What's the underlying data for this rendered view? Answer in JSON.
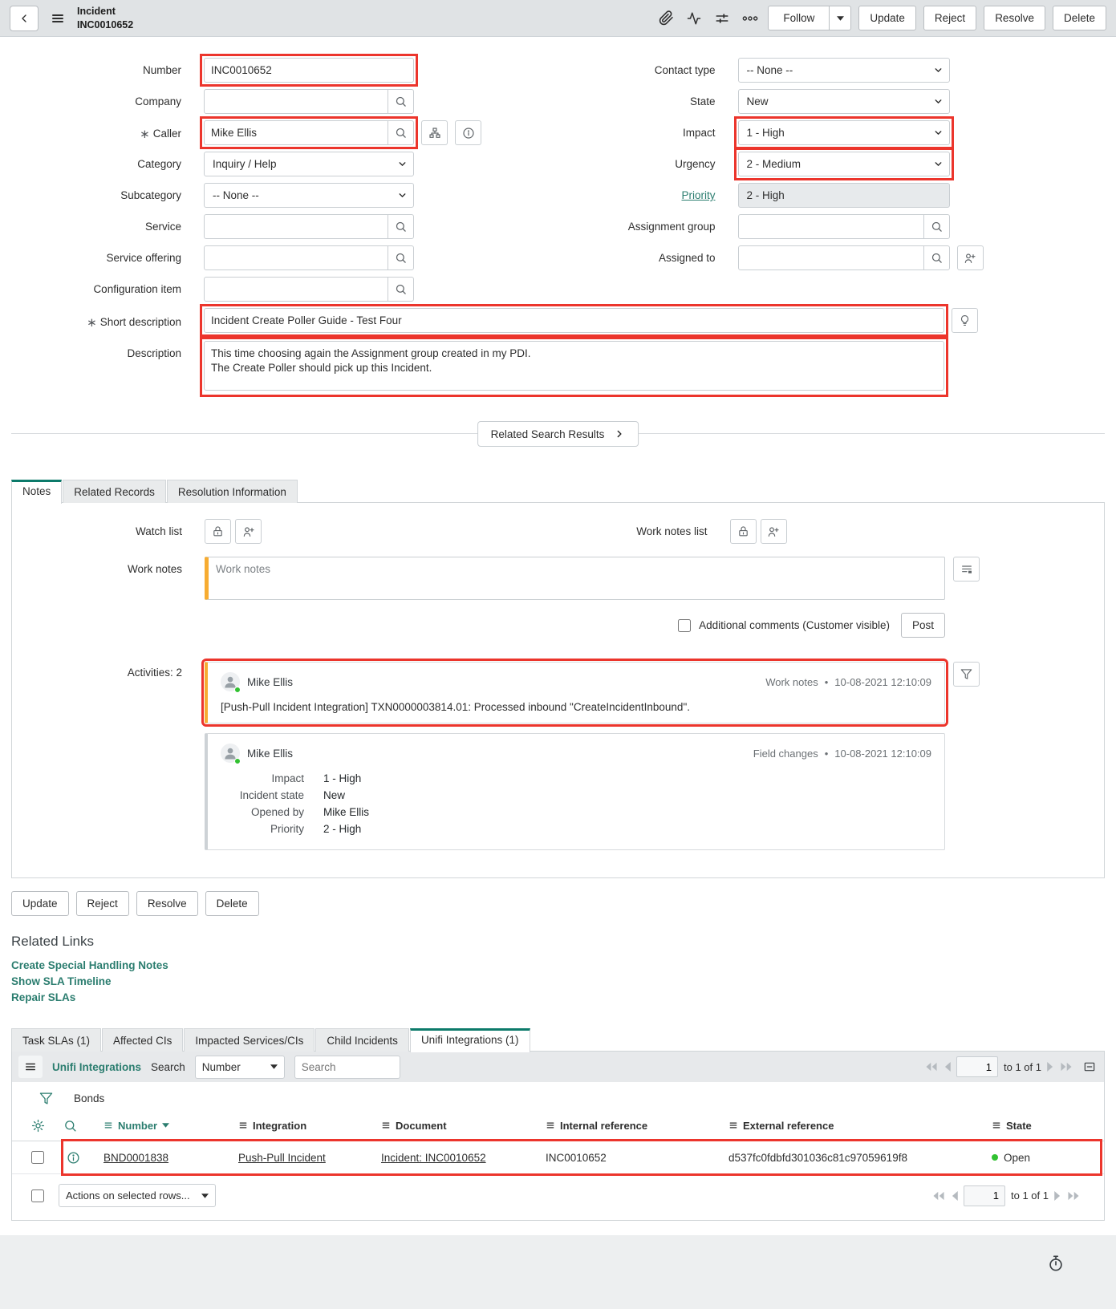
{
  "header": {
    "title": "Incident",
    "record_number": "INC0010652",
    "follow_button": "Follow",
    "update_button": "Update",
    "reject_button": "Reject",
    "resolve_button": "Resolve",
    "delete_button": "Delete"
  },
  "form": {
    "required_indicator": "∗",
    "left": [
      {
        "label": "Number",
        "value": "INC0010652"
      },
      {
        "label": "Company",
        "value": ""
      },
      {
        "label": "Caller",
        "value": "Mike Ellis"
      },
      {
        "label": "Category",
        "value": "Inquiry / Help"
      },
      {
        "label": "Subcategory",
        "value": "-- None --"
      },
      {
        "label": "Service",
        "value": ""
      },
      {
        "label": "Service offering",
        "value": ""
      },
      {
        "label": "Configuration item",
        "value": ""
      }
    ],
    "right": [
      {
        "label": "Contact type",
        "value": "-- None --"
      },
      {
        "label": "State",
        "value": "New"
      },
      {
        "label": "Impact",
        "value": "1 - High"
      },
      {
        "label": "Urgency",
        "value": "2 - Medium"
      },
      {
        "label": "Priority",
        "value": "2 - High"
      },
      {
        "label": "Assignment group",
        "value": ""
      },
      {
        "label": "Assigned to",
        "value": ""
      }
    ],
    "short_description": {
      "label": "Short description",
      "value": "Incident Create Poller Guide - Test Four"
    },
    "description": {
      "label": "Description",
      "value": "This time choosing again the Assignment group created in my PDI.\nThe Create Poller should pick up this Incident."
    }
  },
  "related_search_button": "Related Search Results",
  "tabs": {
    "notes": "Notes",
    "related_records": "Related Records",
    "resolution_information": "Resolution Information"
  },
  "notes": {
    "watch_list_label": "Watch list",
    "work_notes_list_label": "Work notes list",
    "work_notes_label": "Work notes",
    "work_notes_placeholder": "Work notes",
    "additional_comments_label": "Additional comments (Customer visible)",
    "post_button": "Post",
    "activities_label": "Activities: 2",
    "meta_separator": "•",
    "activities": [
      {
        "author": "Mike Ellis",
        "type": "Work notes",
        "timestamp": "10-08-2021 12:10:09",
        "body": "[Push-Pull Incident Integration] TXN0000003814.01: Processed inbound \"CreateIncidentInbound\"."
      },
      {
        "author": "Mike Ellis",
        "type": "Field changes",
        "timestamp": "10-08-2021 12:10:09",
        "fields": [
          {
            "name": "Impact",
            "value": "1 - High"
          },
          {
            "name": "Incident state",
            "value": "New"
          },
          {
            "name": "Opened by",
            "value": "Mike Ellis"
          },
          {
            "name": "Priority",
            "value": "2 - High"
          }
        ]
      }
    ]
  },
  "footer_buttons": {
    "update": "Update",
    "reject": "Reject",
    "resolve": "Resolve",
    "delete": "Delete"
  },
  "related_links": {
    "title": "Related Links",
    "links": [
      "Create Special Handling Notes",
      "Show SLA Timeline",
      "Repair SLAs"
    ]
  },
  "related_lists": {
    "tabs": [
      "Task SLAs (1)",
      "Affected CIs",
      "Impacted Services/CIs",
      "Child Incidents",
      "Unifi Integrations (1)"
    ]
  },
  "unifi_list": {
    "title": "Unifi Integrations",
    "search_label": "Search",
    "search_column": "Number",
    "search_placeholder": "Search",
    "pagination_page": "1",
    "pagination_text": "to 1 of 1",
    "group_label": "Bonds",
    "columns": {
      "number": "Number",
      "integration": "Integration",
      "document": "Document",
      "internal_reference": "Internal reference",
      "external_reference": "External reference",
      "state": "State"
    },
    "row": {
      "number": "BND0001838",
      "integration": "Push-Pull Incident",
      "document": "Incident: INC0010652",
      "internal_reference": "INC0010652",
      "external_reference": "d537fc0fdbfd301036c81c97059619f8",
      "state": "Open"
    },
    "actions_select": "Actions on selected rows...",
    "footer_pagination_page": "1",
    "footer_pagination_text": "to 1 of 1"
  },
  "colors": {
    "accent": "#2b7d6f",
    "tab_accent": "#0c7a6a",
    "highlight": "#ec352c",
    "work_notes_stripe": "#f7ac31",
    "presence_green": "#31c131",
    "state_open_green": "#31c131"
  }
}
